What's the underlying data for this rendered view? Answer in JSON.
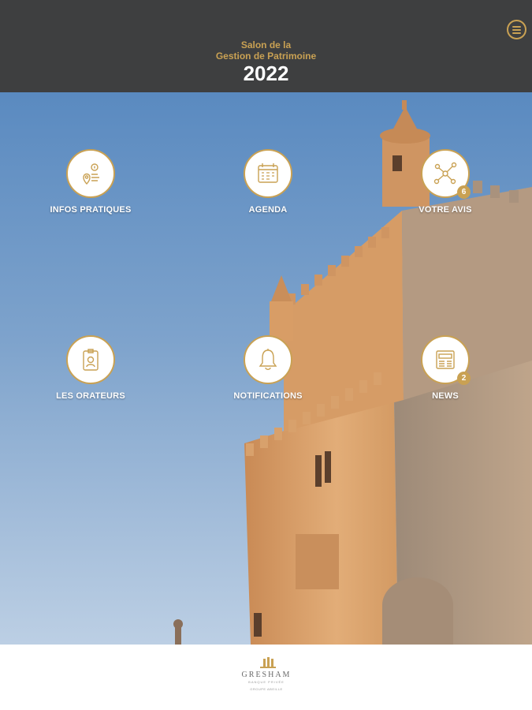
{
  "header": {
    "title_line1": "Salon de la",
    "title_line2": "Gestion de Patrimoine",
    "year": "2022",
    "menu_icon": "hamburger-menu-icon"
  },
  "tiles": [
    {
      "label": "INFOS PRATIQUES",
      "icon": "map-pin-info-icon",
      "badge": ""
    },
    {
      "label": "AGENDA",
      "icon": "calendar-icon",
      "badge": ""
    },
    {
      "label": "VOTRE AVIS",
      "icon": "network-share-icon",
      "badge": "6"
    },
    {
      "label": "LES ORATEURS",
      "icon": "speaker-badge-icon",
      "badge": ""
    },
    {
      "label": "NOTIFICATIONS",
      "icon": "bell-icon",
      "badge": ""
    },
    {
      "label": "NEWS",
      "icon": "newspaper-icon",
      "badge": "2"
    }
  ],
  "footer": {
    "logo_text": "GRESHAM",
    "logo_subtext": "BANQUE PRIVÉE",
    "logo_group": "GROUPE ABEILLE"
  },
  "colors": {
    "header_bg": "#3e3f40",
    "accent_gold": "#c9a153",
    "sky_top": "#5a8ac0",
    "stone": "#d9a46f"
  }
}
